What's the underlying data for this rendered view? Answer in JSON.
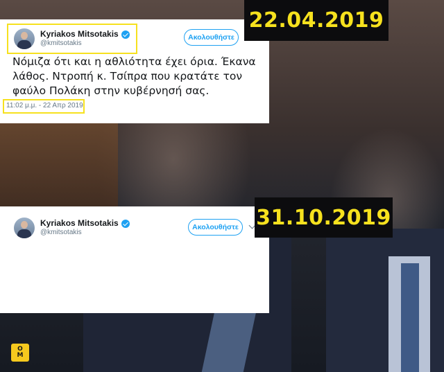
{
  "top_date": "22.04.2019",
  "bottom_date": "31.10.2019",
  "tweet_top": {
    "author_name": "Kyriakos Mitsotakis",
    "handle": "@kmitsotakis",
    "follow_label": "Ακολουθήστε",
    "text": "Νόμιζα ότι και η αθλιότητα έχει όρια.  Έκανα λάθος. Ντροπή κ. Τσίπρα που κρατάτε τον φαύλο Πολάκη στην κυβέρνησή σας.",
    "timestamp": "11:02 μ.μ. - 22 Απρ 2019"
  },
  "tweet_bottom": {
    "author_name": "Kyriakos Mitsotakis",
    "handle": "@kmitsotakis",
    "follow_label": "Ακολουθήστε"
  },
  "logo": {
    "line1": "Ο",
    "line2": "Μ",
    "color": "#f6c91e"
  },
  "colors": {
    "highlight": "#f6e11e",
    "twitter_blue": "#1da1f2",
    "banner_bg": "#0c0c0e"
  }
}
